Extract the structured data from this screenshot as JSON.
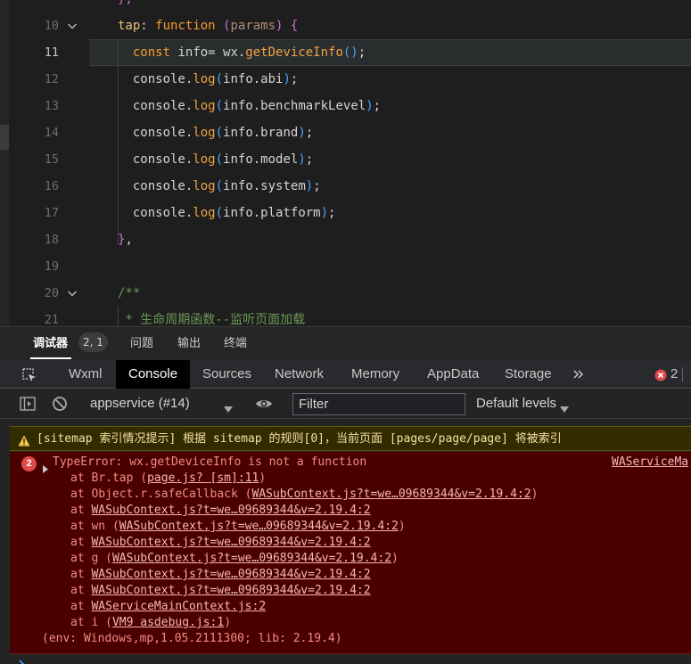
{
  "editor": {
    "lines": [
      {
        "num": "",
        "fold": false,
        "tokens": [
          {
            "t": "},",
            "c": "c-brace2"
          }
        ]
      },
      {
        "num": "10",
        "fold": true,
        "tokens": [
          {
            "t": "tap",
            "c": "c-key"
          },
          {
            "t": ": ",
            "c": "c-id"
          },
          {
            "t": "function",
            "c": "c-kw"
          },
          {
            "t": " ",
            "c": "c-id"
          },
          {
            "t": "(",
            "c": "c-brace2"
          },
          {
            "t": "params",
            "c": "c-par"
          },
          {
            "t": ") ",
            "c": "c-brace2"
          },
          {
            "t": "{",
            "c": "c-brace2"
          }
        ]
      },
      {
        "num": "11",
        "fold": false,
        "active": true,
        "tokens": [
          {
            "t": "  const ",
            "c": "c-kw"
          },
          {
            "t": "info= wx.",
            "c": "c-cn"
          },
          {
            "t": "getDeviceInfo",
            "c": "c-fn"
          },
          {
            "t": "()",
            "c": "c-brace3"
          },
          {
            "t": ";",
            "c": "c-id"
          }
        ]
      },
      {
        "num": "12",
        "fold": false,
        "tokens": [
          {
            "t": "  console.",
            "c": "c-cn"
          },
          {
            "t": "log",
            "c": "c-fn"
          },
          {
            "t": "(",
            "c": "c-brace3"
          },
          {
            "t": "info.abi",
            "c": "c-cn"
          },
          {
            "t": ")",
            "c": "c-brace3"
          },
          {
            "t": ";",
            "c": "c-id"
          }
        ]
      },
      {
        "num": "13",
        "fold": false,
        "tokens": [
          {
            "t": "  console.",
            "c": "c-cn"
          },
          {
            "t": "log",
            "c": "c-fn"
          },
          {
            "t": "(",
            "c": "c-brace3"
          },
          {
            "t": "info.benchmarkLevel",
            "c": "c-cn"
          },
          {
            "t": ")",
            "c": "c-brace3"
          },
          {
            "t": ";",
            "c": "c-id"
          }
        ]
      },
      {
        "num": "14",
        "fold": false,
        "tokens": [
          {
            "t": "  console.",
            "c": "c-cn"
          },
          {
            "t": "log",
            "c": "c-fn"
          },
          {
            "t": "(",
            "c": "c-brace3"
          },
          {
            "t": "info.brand",
            "c": "c-cn"
          },
          {
            "t": ")",
            "c": "c-brace3"
          },
          {
            "t": ";",
            "c": "c-id"
          }
        ]
      },
      {
        "num": "15",
        "fold": false,
        "tokens": [
          {
            "t": "  console.",
            "c": "c-cn"
          },
          {
            "t": "log",
            "c": "c-fn"
          },
          {
            "t": "(",
            "c": "c-brace3"
          },
          {
            "t": "info.model",
            "c": "c-cn"
          },
          {
            "t": ")",
            "c": "c-brace3"
          },
          {
            "t": ";",
            "c": "c-id"
          }
        ]
      },
      {
        "num": "16",
        "fold": false,
        "tokens": [
          {
            "t": "  console.",
            "c": "c-cn"
          },
          {
            "t": "log",
            "c": "c-fn"
          },
          {
            "t": "(",
            "c": "c-brace3"
          },
          {
            "t": "info.system",
            "c": "c-cn"
          },
          {
            "t": ")",
            "c": "c-brace3"
          },
          {
            "t": ";",
            "c": "c-id"
          }
        ]
      },
      {
        "num": "17",
        "fold": false,
        "tokens": [
          {
            "t": "  console.",
            "c": "c-cn"
          },
          {
            "t": "log",
            "c": "c-fn"
          },
          {
            "t": "(",
            "c": "c-brace3"
          },
          {
            "t": "info.platform",
            "c": "c-cn"
          },
          {
            "t": ")",
            "c": "c-brace3"
          },
          {
            "t": ";",
            "c": "c-id"
          }
        ]
      },
      {
        "num": "18",
        "fold": false,
        "tokens": [
          {
            "t": "}",
            "c": "c-brace2"
          },
          {
            "t": ",",
            "c": "c-id"
          }
        ]
      },
      {
        "num": "19",
        "fold": false,
        "tokens": []
      },
      {
        "num": "20",
        "fold": true,
        "tokens": [
          {
            "t": "/**",
            "c": "c-cmt"
          }
        ]
      },
      {
        "num": "21",
        "fold": false,
        "tokens": [
          {
            "t": " * 生命周期函数--监听页面加载",
            "c": "c-cmt"
          }
        ]
      }
    ]
  },
  "devtools": {
    "top_tabs": {
      "debugger": "调试器",
      "badge": "2, 1",
      "issues": "问题",
      "output": "输出",
      "terminal": "终端"
    },
    "panels": [
      "Wxml",
      "Console",
      "Sources",
      "Network",
      "Memory",
      "AppData",
      "Storage"
    ],
    "active_panel": "Console",
    "error_count": "2",
    "toolbar": {
      "context": "appservice (#14)",
      "filter_placeholder": "Filter",
      "levels": "Default levels"
    }
  },
  "console": {
    "warning": "[sitemap 索引情况提示] 根据 sitemap 的规则[0]，当前页面 [pages/page/page] 将被索引",
    "error": {
      "count": "2",
      "title": "TypeError: wx.getDeviceInfo is not a function",
      "source": "WAServiceMa",
      "frames": [
        {
          "pre": "at Br.tap (",
          "link": "page.js? [sm]:11",
          "post": ")"
        },
        {
          "pre": "at Object.r.safeCallback (",
          "link": "WASubContext.js?t=we…09689344&v=2.19.4:2",
          "post": ")"
        },
        {
          "pre": "at ",
          "link": "WASubContext.js?t=we…09689344&v=2.19.4:2",
          "post": ""
        },
        {
          "pre": "at wn (",
          "link": "WASubContext.js?t=we…09689344&v=2.19.4:2",
          "post": ")"
        },
        {
          "pre": "at ",
          "link": "WASubContext.js?t=we…09689344&v=2.19.4:2",
          "post": ""
        },
        {
          "pre": "at g (",
          "link": "WASubContext.js?t=we…09689344&v=2.19.4:2",
          "post": ")"
        },
        {
          "pre": "at ",
          "link": "WASubContext.js?t=we…09689344&v=2.19.4:2",
          "post": ""
        },
        {
          "pre": "at ",
          "link": "WASubContext.js?t=we…09689344&v=2.19.4:2",
          "post": ""
        },
        {
          "pre": "at ",
          "link": "WAServiceMainContext.js:2",
          "post": ""
        },
        {
          "pre": "at i (",
          "link": "VM9 asdebug.js:1",
          "post": ")"
        }
      ],
      "env": "(env: Windows,mp,1.05.2111300; lib: 2.19.4)"
    }
  },
  "colors": {
    "error_bg": "#4a0000",
    "warning_bg": "#332b00",
    "active_tab_bg": "#000000",
    "error_badge": "#e04848"
  }
}
